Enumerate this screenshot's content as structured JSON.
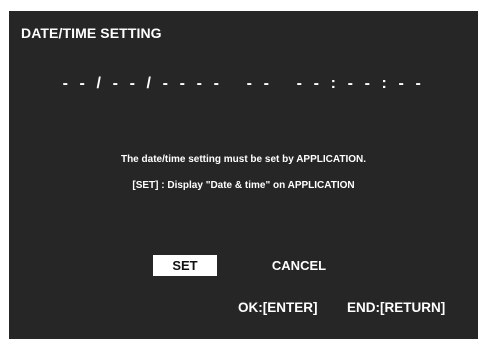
{
  "window": {
    "title": "DATE/TIME SETTING"
  },
  "datetime_display": "- - / - - / - - - -   - -   - - : - - : - -",
  "messages": {
    "line1": "The date/time setting must be set by APPLICATION.",
    "line2": "[SET] : Display \"Date & time\" on APPLICATION"
  },
  "buttons": {
    "set_label": "SET",
    "cancel_label": "CANCEL",
    "selected": "SET"
  },
  "key_hints": {
    "ok": "OK:[ENTER]",
    "end": "END:[RETURN]"
  },
  "colors": {
    "background": "#262626",
    "text": "#ffffff",
    "selected_button_bg": "#ffffff",
    "selected_button_text": "#111111"
  }
}
